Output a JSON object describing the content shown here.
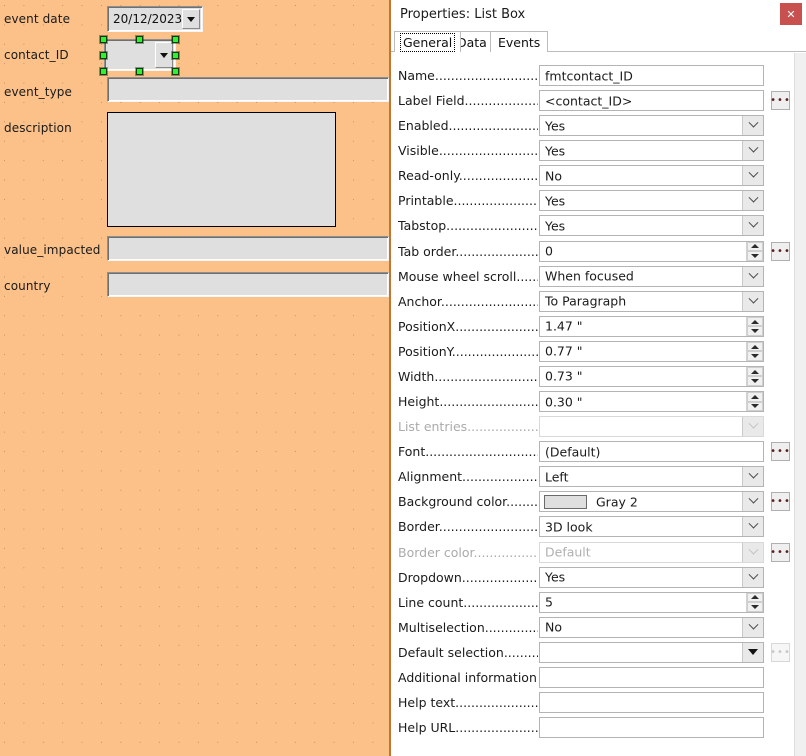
{
  "form": {
    "background_color": "#fbc189",
    "fields": [
      {
        "label": "event date",
        "type": "date-combo",
        "value": "20/12/2023",
        "selected": false
      },
      {
        "label": "contact_ID",
        "type": "list-combo",
        "value": "",
        "selected": true
      },
      {
        "label": "event_type",
        "type": "text",
        "value": "",
        "selected": false
      },
      {
        "label": "description",
        "type": "textarea",
        "value": "",
        "selected": false
      },
      {
        "label": "value_impacted",
        "type": "text",
        "value": "",
        "selected": false
      },
      {
        "label": "country",
        "type": "text",
        "value": "",
        "selected": false
      }
    ]
  },
  "dialog": {
    "title": "Properties: List Box",
    "close_label": "✕",
    "accent_close_color": "#c8504f",
    "tabs": [
      {
        "label": "General",
        "active": true
      },
      {
        "label": "Data",
        "active": false
      },
      {
        "label": "Events",
        "active": false
      }
    ],
    "properties": [
      {
        "label": "Name.................................",
        "value": "fmtcontact_ID",
        "control": "text",
        "disabled": false,
        "browse": false
      },
      {
        "label": "Label Field............................",
        "value": "<contact_ID>",
        "control": "text",
        "disabled": false,
        "browse": true
      },
      {
        "label": "Enabled...............................",
        "value": "Yes",
        "control": "combo",
        "disabled": false,
        "browse": false
      },
      {
        "label": "Visible.................................",
        "value": "Yes",
        "control": "combo",
        "disabled": false,
        "browse": false
      },
      {
        "label": "Read-only............................",
        "value": "No",
        "control": "combo",
        "disabled": false,
        "browse": false
      },
      {
        "label": "Printable..............................",
        "value": "Yes",
        "control": "combo",
        "disabled": false,
        "browse": false
      },
      {
        "label": "Tabstop...............................",
        "value": "Yes",
        "control": "combo",
        "disabled": false,
        "browse": false
      },
      {
        "label": "Tab order.............................",
        "value": "0",
        "control": "spinner",
        "disabled": false,
        "browse": true
      },
      {
        "label": "Mouse wheel scroll............",
        "value": "When focused",
        "control": "combo",
        "disabled": false,
        "browse": false
      },
      {
        "label": "Anchor.................................",
        "value": "To Paragraph",
        "control": "combo",
        "disabled": false,
        "browse": false
      },
      {
        "label": "PositionX.............................",
        "value": "1.47 \"",
        "control": "spinner",
        "disabled": false,
        "browse": false
      },
      {
        "label": "PositionY.............................",
        "value": "0.77 \"",
        "control": "spinner",
        "disabled": false,
        "browse": false
      },
      {
        "label": "Width..................................",
        "value": "0.73 \"",
        "control": "spinner",
        "disabled": false,
        "browse": false
      },
      {
        "label": "Height.................................",
        "value": "0.30 \"",
        "control": "spinner",
        "disabled": false,
        "browse": false
      },
      {
        "label": "List entries...........................",
        "value": "",
        "control": "combo",
        "disabled": true,
        "browse": false
      },
      {
        "label": "Font....................................",
        "value": "(Default)",
        "control": "text",
        "disabled": false,
        "browse": true
      },
      {
        "label": "Alignment...........................",
        "value": "Left",
        "control": "combo",
        "disabled": false,
        "browse": false
      },
      {
        "label": "Background color..............",
        "value": "Gray 2",
        "control": "color",
        "disabled": false,
        "browse": true,
        "swatch_color": "#dfdfdf"
      },
      {
        "label": "Border.................................",
        "value": "3D look",
        "control": "combo",
        "disabled": false,
        "browse": false
      },
      {
        "label": "Border color.........................",
        "value": "Default",
        "control": "combo",
        "disabled": true,
        "browse": true
      },
      {
        "label": "Dropdown...........................",
        "value": "Yes",
        "control": "combo",
        "disabled": false,
        "browse": false
      },
      {
        "label": "Line count............................",
        "value": "5",
        "control": "spinner",
        "disabled": false,
        "browse": false
      },
      {
        "label": "Multiselection....................",
        "value": "No",
        "control": "combo",
        "disabled": false,
        "browse": false
      },
      {
        "label": "Default selection...............",
        "value": "",
        "control": "combo-solid",
        "disabled": false,
        "browse": true,
        "browse_disabled": true
      },
      {
        "label": "Additional information.....",
        "value": "",
        "control": "text",
        "disabled": false,
        "browse": false
      },
      {
        "label": "Help text.............................",
        "value": "",
        "control": "text",
        "disabled": false,
        "browse": false
      },
      {
        "label": "Help URL.............................",
        "value": "",
        "control": "text",
        "disabled": false,
        "browse": false
      }
    ]
  }
}
